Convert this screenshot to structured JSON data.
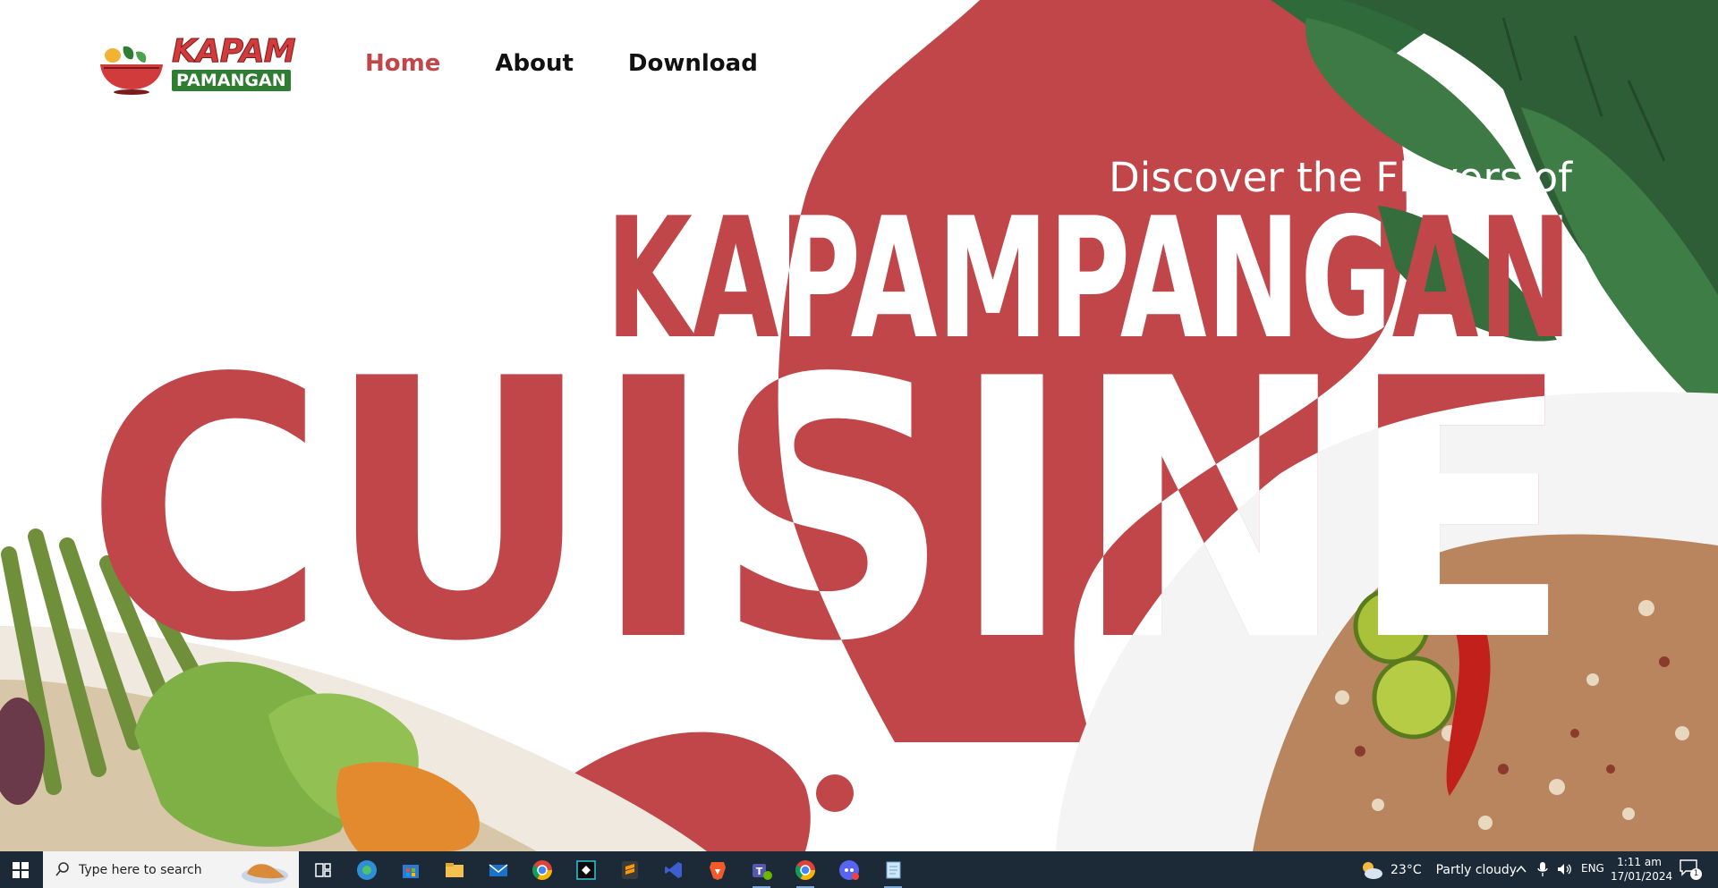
{
  "brand": {
    "logo_word_1": "KAPAM",
    "logo_word_2": "PAMANGAN",
    "colors": {
      "accent": "#c0464a",
      "green": "#2e7d32"
    }
  },
  "nav": {
    "items": [
      {
        "label": "Home",
        "active": true
      },
      {
        "label": "About",
        "active": false
      },
      {
        "label": "Download",
        "active": false
      }
    ]
  },
  "hero": {
    "subtitle": "Discover the Flavors of",
    "title_line1": "KAPAMPANGAN",
    "title_line2": "CUISINE"
  },
  "taskbar": {
    "search_placeholder": "Type here to search",
    "weather_temp": "23°C",
    "weather_text": "Partly cloudy",
    "language": "ENG",
    "time": "1:11 am",
    "date": "17/01/2024",
    "notification_count": "1",
    "pinned_icons": [
      "task-view-icon",
      "edge-icon",
      "store-icon",
      "file-explorer-icon",
      "mail-icon",
      "chrome-icon",
      "capcut-icon",
      "sublime-text-icon",
      "vscode-icon",
      "brave-icon",
      "teams-icon",
      "chrome-profile-icon",
      "discord-icon",
      "notepad-icon"
    ]
  }
}
